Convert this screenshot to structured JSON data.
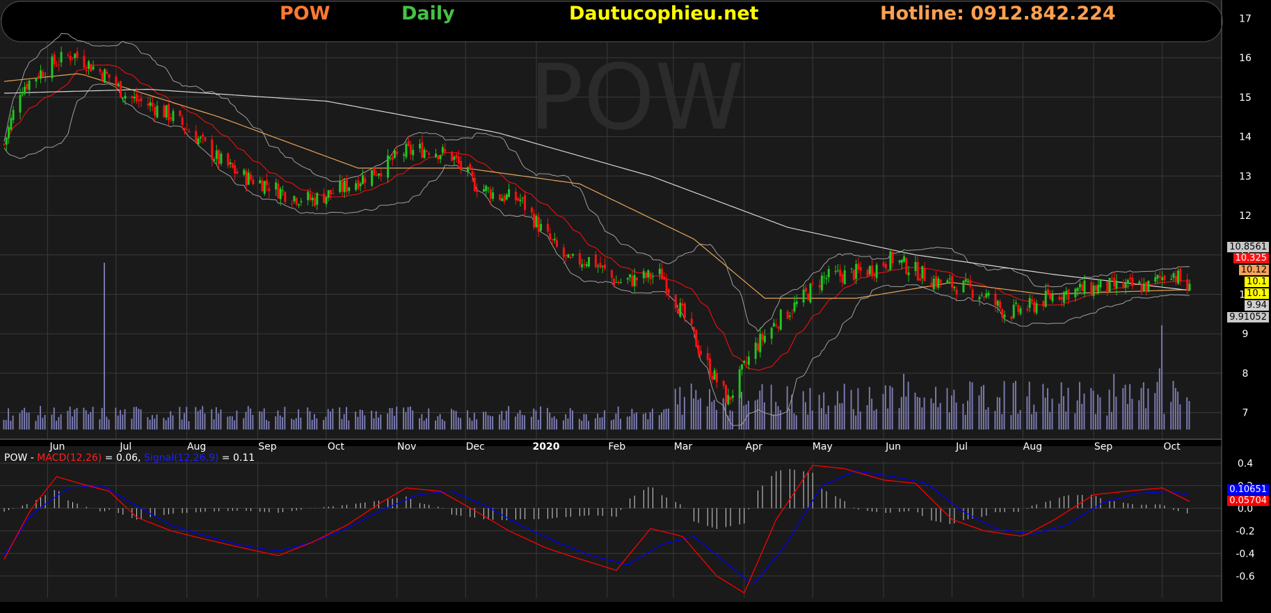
{
  "header": {
    "symbol": "POW",
    "interval": "Daily",
    "site": "Dautucophieu.net",
    "hotline": "Hotline: 0912.842.224"
  },
  "colors": {
    "background": "#000000",
    "panel": "#1a1a1a",
    "grid": "#3a3a3a",
    "candle_up": "#22c522",
    "candle_down": "#ff1010",
    "ma_fast": "#e01010",
    "ma_mid": "#e8a55a",
    "ma_slow": "#d8d8d8",
    "bollinger": "#a0a0a0",
    "volume": "#7a7ab0",
    "macd": "#ff0000",
    "signal": "#0000ff",
    "hist": "#d8d8d8",
    "symbol_text": "#ff7a30",
    "interval_text": "#44c244",
    "site_text": "#ffff00",
    "hotline_text": "#ffa050"
  },
  "chart_data": [
    {
      "type": "candlestick",
      "symbol": "POW",
      "interval": "Daily",
      "watermark": "POW",
      "ylim": [
        6.8,
        17.2
      ],
      "y_ticks": [
        "7",
        "8",
        "9",
        "10",
        "11",
        "12",
        "13",
        "14",
        "15",
        "16",
        "17"
      ],
      "x_ticks": [
        "Jun",
        "Jul",
        "Aug",
        "Sep",
        "Oct",
        "Nov",
        "Dec",
        "2020",
        "Feb",
        "Mar",
        "Apr",
        "May",
        "Jun",
        "Jul",
        "Aug",
        "Sep",
        "Oct"
      ],
      "price_path": {
        "x": [
          "2019-05-13",
          "2019-05-20",
          "2019-05-28",
          "2019-06-05",
          "2019-06-12",
          "2019-06-20",
          "2019-06-28",
          "2019-07-06",
          "2019-07-16",
          "2019-07-26",
          "2019-08-05",
          "2019-08-15",
          "2019-08-25",
          "2019-09-05",
          "2019-09-15",
          "2019-09-25",
          "2019-10-05",
          "2019-10-15",
          "2019-10-25",
          "2019-11-04",
          "2019-11-15",
          "2019-11-25",
          "2019-12-05",
          "2019-12-15",
          "2019-12-25",
          "2020-01-05",
          "2020-01-15",
          "2020-01-25",
          "2020-02-05",
          "2020-02-15",
          "2020-02-25",
          "2020-03-05",
          "2020-03-15",
          "2020-03-25",
          "2020-04-05",
          "2020-04-15",
          "2020-04-25",
          "2020-05-05",
          "2020-05-15",
          "2020-05-25",
          "2020-06-05",
          "2020-06-15",
          "2020-06-25",
          "2020-07-05",
          "2020-07-15",
          "2020-07-25",
          "2020-08-05",
          "2020-08-15",
          "2020-08-25",
          "2020-09-05",
          "2020-09-15",
          "2020-09-25",
          "2020-10-05",
          "2020-10-13"
        ],
        "y": [
          13.8,
          15.2,
          15.6,
          15.9,
          16.1,
          15.8,
          15.5,
          15.0,
          14.8,
          14.5,
          14.0,
          13.4,
          13.0,
          12.8,
          12.5,
          12.4,
          12.6,
          12.9,
          13.2,
          13.6,
          13.7,
          13.5,
          12.8,
          12.5,
          12.4,
          11.5,
          10.8,
          10.9,
          10.3,
          10.4,
          10.5,
          9.5,
          8.3,
          7.3,
          8.6,
          9.3,
          9.8,
          10.4,
          10.5,
          10.6,
          10.9,
          10.6,
          10.3,
          10.2,
          10.0,
          9.5,
          9.7,
          10.0,
          10.1,
          10.2,
          10.2,
          10.2,
          10.6,
          10.1
        ]
      },
      "last_value_labels": [
        "10.8561",
        "10.325",
        "10.12",
        "10.1",
        "10.1",
        "9.94",
        "9.91052"
      ],
      "ma_slow": {
        "x": [
          "2019-05-13",
          "2019-07-15",
          "2019-10-01",
          "2019-12-15",
          "2020-02-20",
          "2020-04-20",
          "2020-06-15",
          "2020-08-15",
          "2020-10-13"
        ],
        "y": [
          15.1,
          15.2,
          14.9,
          14.1,
          13.0,
          11.7,
          11.0,
          10.5,
          10.1
        ]
      },
      "ma_mid": {
        "x": [
          "2019-05-13",
          "2019-06-15",
          "2019-08-15",
          "2019-10-15",
          "2019-12-01",
          "2020-01-20",
          "2020-03-10",
          "2020-04-10",
          "2020-05-20",
          "2020-07-01",
          "2020-08-10",
          "2020-10-13"
        ],
        "y": [
          15.4,
          15.6,
          14.5,
          13.2,
          13.2,
          12.8,
          11.4,
          9.9,
          9.9,
          10.3,
          10.0,
          10.12
        ]
      }
    },
    {
      "type": "line",
      "title": "POW - MACD(12,26) = 0.06, Signal(12,26,9) = 0.11",
      "series": [
        {
          "name": "MACD(12,26)",
          "value_text": "0.06",
          "last_label": "0.05704"
        },
        {
          "name": "Signal(12,26,9)",
          "value_text": "0.11",
          "last_label": "0.10651"
        }
      ],
      "ylim": [
        -0.78,
        0.42
      ],
      "y_ticks": [
        "0.4",
        "0.2",
        "0.0",
        "-0.2",
        "-0.4",
        "-0.6"
      ],
      "macd": {
        "x": [
          "2019-05-13",
          "2019-05-25",
          "2019-06-05",
          "2019-06-15",
          "2019-06-28",
          "2019-07-10",
          "2019-07-25",
          "2019-08-10",
          "2019-08-25",
          "2019-09-10",
          "2019-09-25",
          "2019-10-10",
          "2019-10-25",
          "2019-11-05",
          "2019-11-20",
          "2019-12-05",
          "2019-12-20",
          "2020-01-05",
          "2020-01-20",
          "2020-02-05",
          "2020-02-20",
          "2020-03-05",
          "2020-03-20",
          "2020-04-01",
          "2020-04-15",
          "2020-05-01",
          "2020-05-15",
          "2020-06-01",
          "2020-06-15",
          "2020-07-01",
          "2020-07-15",
          "2020-08-01",
          "2020-08-15",
          "2020-09-01",
          "2020-09-15",
          "2020-10-01",
          "2020-10-13"
        ],
        "y": [
          -0.45,
          0.0,
          0.28,
          0.22,
          0.15,
          -0.08,
          -0.2,
          -0.28,
          -0.35,
          -0.42,
          -0.3,
          -0.15,
          0.05,
          0.18,
          0.15,
          -0.02,
          -0.2,
          -0.35,
          -0.45,
          -0.55,
          -0.18,
          -0.25,
          -0.6,
          -0.75,
          -0.1,
          0.38,
          0.35,
          0.25,
          0.22,
          -0.1,
          -0.2,
          -0.25,
          -0.1,
          0.12,
          0.15,
          0.18,
          0.06
        ]
      },
      "signal": {
        "x": [
          "2019-05-13",
          "2019-05-25",
          "2019-06-10",
          "2019-06-25",
          "2019-07-10",
          "2019-07-25",
          "2019-08-10",
          "2019-08-25",
          "2019-09-10",
          "2019-09-25",
          "2019-10-10",
          "2019-10-25",
          "2019-11-10",
          "2019-11-25",
          "2019-12-10",
          "2019-12-25",
          "2020-01-10",
          "2020-01-25",
          "2020-02-10",
          "2020-02-25",
          "2020-03-10",
          "2020-03-25",
          "2020-04-05",
          "2020-04-20",
          "2020-05-05",
          "2020-05-20",
          "2020-06-05",
          "2020-06-20",
          "2020-07-05",
          "2020-07-20",
          "2020-08-05",
          "2020-08-20",
          "2020-09-05",
          "2020-09-20",
          "2020-10-05",
          "2020-10-13"
        ],
        "y": [
          -0.42,
          -0.05,
          0.18,
          0.2,
          0.02,
          -0.15,
          -0.25,
          -0.33,
          -0.38,
          -0.3,
          -0.18,
          -0.02,
          0.12,
          0.15,
          0.02,
          -0.15,
          -0.3,
          -0.42,
          -0.5,
          -0.32,
          -0.25,
          -0.5,
          -0.68,
          -0.3,
          0.2,
          0.33,
          0.28,
          0.22,
          -0.02,
          -0.18,
          -0.23,
          -0.15,
          0.05,
          0.13,
          0.15,
          0.11
        ]
      }
    }
  ]
}
